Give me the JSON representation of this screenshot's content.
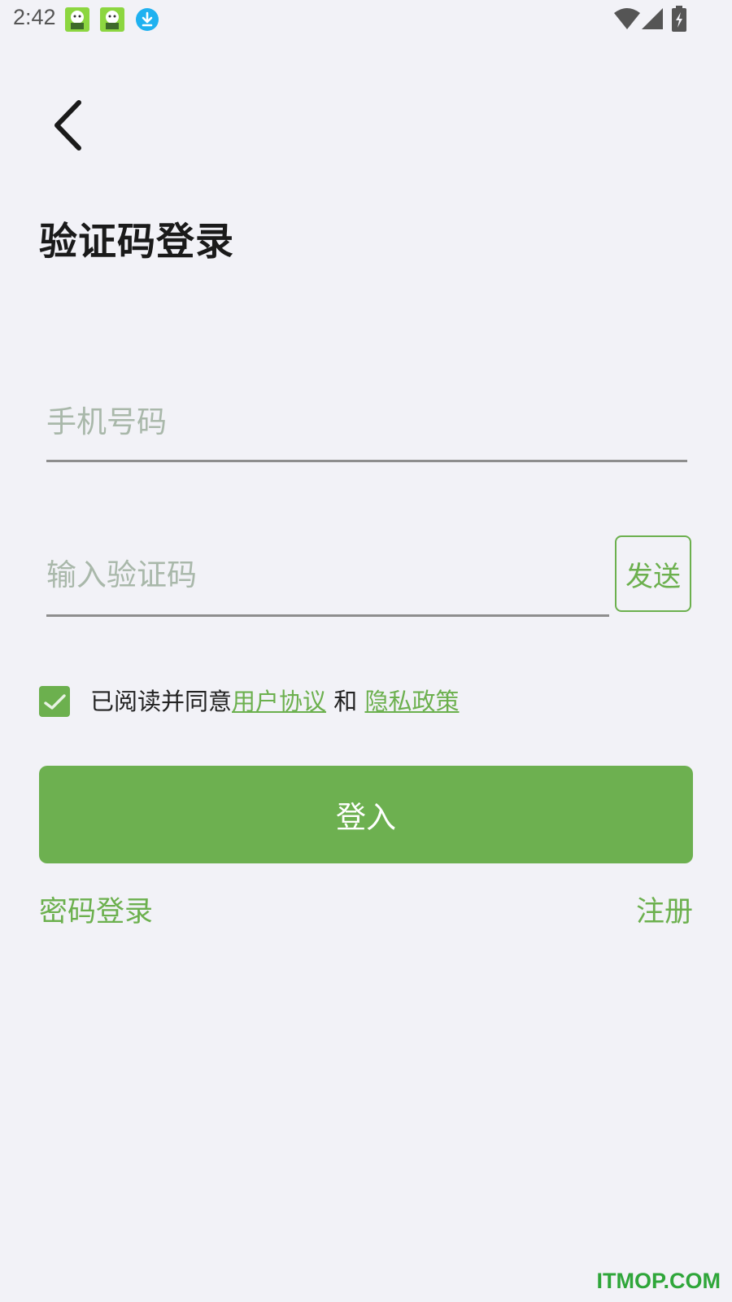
{
  "status_bar": {
    "time": "2:42",
    "notification_icons": [
      "android-app-icon",
      "android-app-icon",
      "download-icon"
    ]
  },
  "header": {
    "title": "验证码登录"
  },
  "form": {
    "phone_placeholder": "手机号码",
    "phone_value": "",
    "code_placeholder": "输入验证码",
    "code_value": "",
    "send_label": "发送"
  },
  "agreement": {
    "checked": true,
    "prefix": "已阅读并同意",
    "user_agreement": "用户协议",
    "conjunction": " 和 ",
    "privacy_policy": "隐私政策"
  },
  "actions": {
    "login_label": "登入",
    "password_login_label": "密码登录",
    "register_label": "注册"
  },
  "watermark": "ITMOP.COM",
  "colors": {
    "accent": "#6cb04e",
    "background": "#f2f2f7",
    "placeholder": "#a9b8aa"
  }
}
